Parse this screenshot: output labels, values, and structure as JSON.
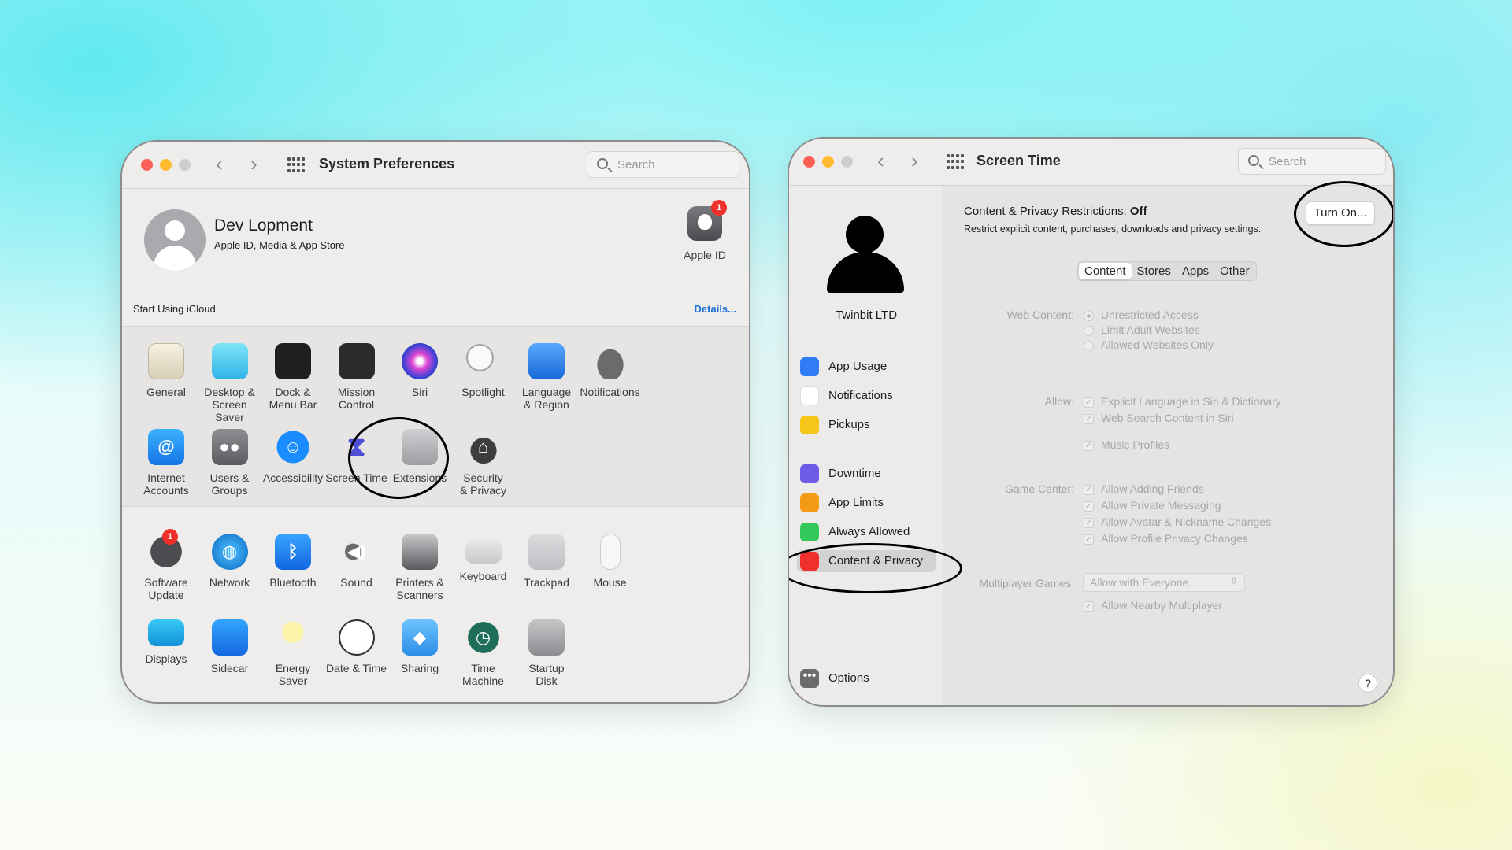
{
  "sysprefs": {
    "title": "System Preferences",
    "search_placeholder": "Search",
    "nav": {
      "back": "‹",
      "forward": "›"
    },
    "user": {
      "name": "Dev Lopment",
      "subtitle": "Apple ID, Media & App Store"
    },
    "apple_id": {
      "label": "Apple ID",
      "badge": "1"
    },
    "icloud": {
      "label": "Start Using iCloud",
      "details": "Details..."
    },
    "row1": [
      {
        "label": "General",
        "icon": "general-icon"
      },
      {
        "label": "Desktop &\nScreen Saver",
        "icon": "desktop-icon"
      },
      {
        "label": "Dock &\nMenu Bar",
        "icon": "dock-icon"
      },
      {
        "label": "Mission\nControl",
        "icon": "mission-control-icon"
      },
      {
        "label": "Siri",
        "icon": "siri-icon"
      },
      {
        "label": "Spotlight",
        "icon": "spotlight-icon"
      },
      {
        "label": "Language\n& Region",
        "icon": "language-icon"
      },
      {
        "label": "Notifications",
        "icon": "notifications-icon"
      }
    ],
    "row2": [
      {
        "label": "Internet\nAccounts",
        "icon": "internet-accounts-icon"
      },
      {
        "label": "Users &\nGroups",
        "icon": "users-icon"
      },
      {
        "label": "Accessibility",
        "icon": "accessibility-icon"
      },
      {
        "label": "Screen Time",
        "icon": "screen-time-icon"
      },
      {
        "label": "Extensions",
        "icon": "extensions-icon"
      },
      {
        "label": "Security\n& Privacy",
        "icon": "security-icon"
      }
    ],
    "row3": [
      {
        "label": "Software\nUpdate",
        "icon": "software-update-icon",
        "badge": "1"
      },
      {
        "label": "Network",
        "icon": "network-icon"
      },
      {
        "label": "Bluetooth",
        "icon": "bluetooth-icon"
      },
      {
        "label": "Sound",
        "icon": "sound-icon"
      },
      {
        "label": "Printers &\nScanners",
        "icon": "printers-icon"
      },
      {
        "label": "Keyboard",
        "icon": "keyboard-icon"
      },
      {
        "label": "Trackpad",
        "icon": "trackpad-icon"
      },
      {
        "label": "Mouse",
        "icon": "mouse-icon"
      }
    ],
    "row4": [
      {
        "label": "Displays",
        "icon": "displays-icon"
      },
      {
        "label": "Sidecar",
        "icon": "sidecar-icon"
      },
      {
        "label": "Energy\nSaver",
        "icon": "energy-saver-icon"
      },
      {
        "label": "Date & Time",
        "icon": "date-time-icon"
      },
      {
        "label": "Sharing",
        "icon": "sharing-icon"
      },
      {
        "label": "Time\nMachine",
        "icon": "time-machine-icon"
      },
      {
        "label": "Startup\nDisk",
        "icon": "startup-disk-icon"
      }
    ]
  },
  "screentime": {
    "title": "Screen Time",
    "search_placeholder": "Search",
    "nav": {
      "back": "‹",
      "forward": "›"
    },
    "user": "Twinbit LTD",
    "sidebar": [
      {
        "label": "App Usage",
        "icon": "app-usage-icon",
        "color": "#2f7cf6"
      },
      {
        "label": "Notifications",
        "icon": "notifications-icon",
        "color": "#ffffff"
      },
      {
        "label": "Pickups",
        "icon": "pickups-icon",
        "color": "#f5c518"
      },
      {
        "label": "Downtime",
        "icon": "downtime-icon",
        "color": "#6e5ce6"
      },
      {
        "label": "App Limits",
        "icon": "app-limits-icon",
        "color": "#f59a14"
      },
      {
        "label": "Always Allowed",
        "icon": "always-allowed-icon",
        "color": "#34c759"
      },
      {
        "label": "Content & Privacy",
        "icon": "content-privacy-icon",
        "color": "#f0302a"
      }
    ],
    "options": "Options",
    "restrictions": {
      "label": "Content & Privacy Restrictions:",
      "state": "Off",
      "desc": "Restrict explicit content, purchases, downloads and privacy settings.",
      "button": "Turn On..."
    },
    "tabs": [
      "Content",
      "Stores",
      "Apps",
      "Other"
    ],
    "web_content": {
      "label": "Web Content:",
      "options": [
        "Unrestricted Access",
        "Limit Adult Websites",
        "Allowed Websites Only"
      ]
    },
    "allow": {
      "label": "Allow:",
      "items": [
        "Explicit Language in Siri & Dictionary",
        "Web Search Content in Siri",
        "Music Profiles"
      ]
    },
    "game_center": {
      "label": "Game Center:",
      "items": [
        "Allow Adding Friends",
        "Allow Private Messaging",
        "Allow Avatar & Nickname Changes",
        "Allow Profile Privacy Changes"
      ]
    },
    "multiplayer": {
      "label": "Multiplayer Games:",
      "value": "Allow with Everyone",
      "nearby": "Allow Nearby Multiplayer"
    },
    "help": "?"
  }
}
